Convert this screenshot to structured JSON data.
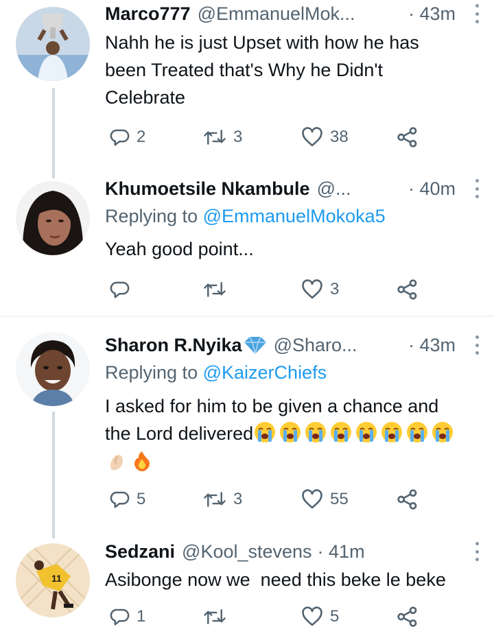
{
  "tweets": [
    {
      "name": "Marco777",
      "handle": "@EmmanuelMok...",
      "time": "· 43m",
      "body_lines": [
        "Nahh he is just Upset with how he has",
        "been Treated that's Why he Didn't",
        "Celebrate"
      ],
      "reply_count": "2",
      "retweet_count": "3",
      "like_count": "38"
    },
    {
      "name": "Khumoetsile Nkambule",
      "handle": "@...",
      "time": "· 40m",
      "replying_prefix": "Replying to",
      "replying_to": "@EmmanuelMokoka5",
      "body_lines": [
        "Yeah good point..."
      ],
      "reply_count": "",
      "retweet_count": "",
      "like_count": "3"
    },
    {
      "name": "Sharon R.Nyika",
      "handle": "@Sharo...",
      "time": "· 43m",
      "replying_prefix": "Replying to",
      "replying_to": "@KaizerChiefs",
      "body_lines": [
        "I asked for him to be given a chance and",
        "the Lord delivered"
      ],
      "body_emojis": [
        "loudly-crying-face",
        "loudly-crying-face",
        "loudly-crying-face",
        "loudly-crying-face",
        "loudly-crying-face",
        "loudly-crying-face",
        "loudly-crying-face",
        "loudly-crying-face",
        "pinching-hand",
        "fire"
      ],
      "reply_count": "5",
      "retweet_count": "3",
      "like_count": "55"
    },
    {
      "name": "Sedzani",
      "handle": "@Kool_stevens",
      "time": "· 41m",
      "body_lines": [
        "Asibonge now we  need this beke le beke"
      ],
      "reply_count": "1",
      "retweet_count": "",
      "like_count": "5"
    }
  ],
  "colors": {
    "text": "#0f1419",
    "secondary": "#536471",
    "link": "#1d9bf0",
    "verified": "#4aa3df",
    "thread_line": "#cfd9de"
  },
  "icons": [
    "reply-icon",
    "retweet-icon",
    "like-icon",
    "share-icon",
    "more-icon",
    "verified-icon"
  ]
}
